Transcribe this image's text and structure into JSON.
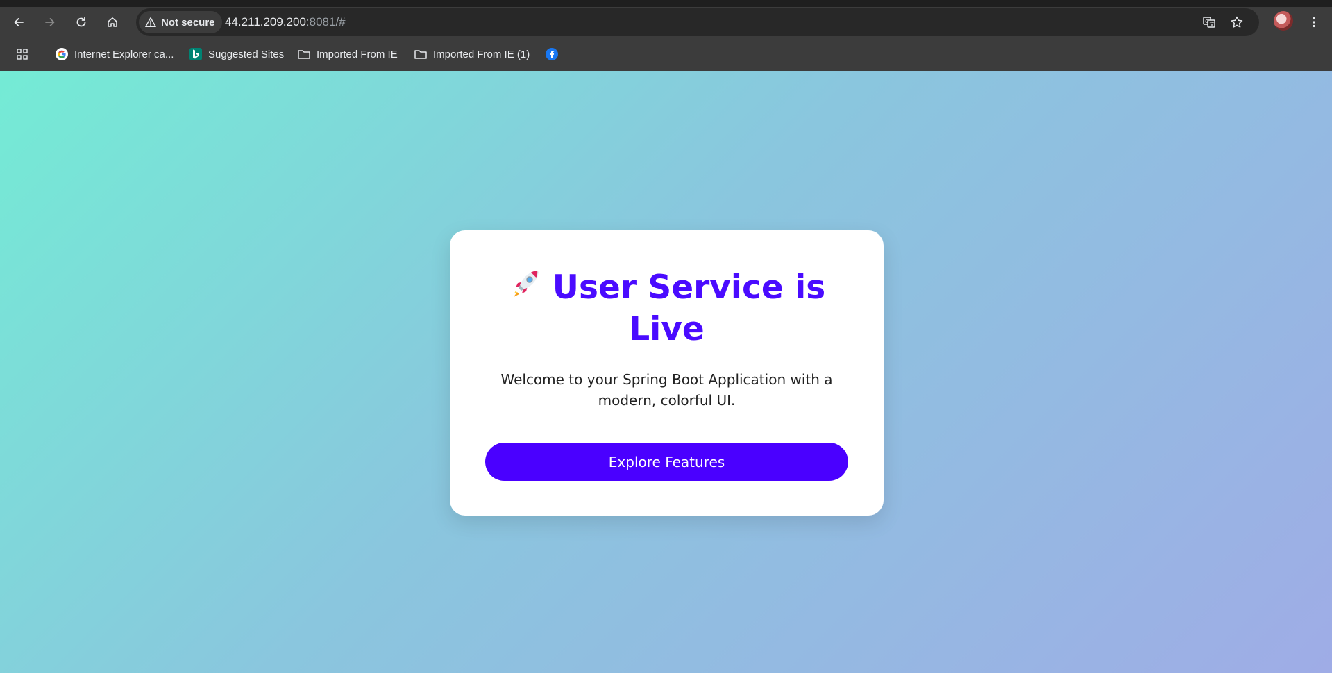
{
  "browser": {
    "security_chip": {
      "label": "Not secure",
      "icon": "warning-triangle-icon"
    },
    "url": {
      "host": "44.211.209.200",
      "rest": ":8081/#"
    },
    "nav_icons": [
      "back-arrow-icon",
      "forward-arrow-icon",
      "reload-icon",
      "home-icon"
    ],
    "right_icons": [
      "translate-icon",
      "star-icon",
      "avatar",
      "kebab-menu-icon"
    ]
  },
  "bookmarks": {
    "items": [
      {
        "label": "Internet Explorer ca...",
        "icon": "google-icon"
      },
      {
        "label": "Suggested Sites",
        "icon": "bing-icon"
      },
      {
        "label": "Imported From IE",
        "icon": "folder-icon"
      },
      {
        "label": "Imported From IE (1)",
        "icon": "folder-icon"
      },
      {
        "label": "",
        "icon": "facebook-icon"
      }
    ]
  },
  "card": {
    "title": "User Service is Live",
    "subtitle": "Welcome to your Spring Boot Application with a modern, colorful UI.",
    "button_label": "Explore Features"
  },
  "colors": {
    "accent": "#4a00ff",
    "title": "#4a0bff",
    "bg_start": "#74ebd5",
    "bg_end": "#9face6"
  }
}
